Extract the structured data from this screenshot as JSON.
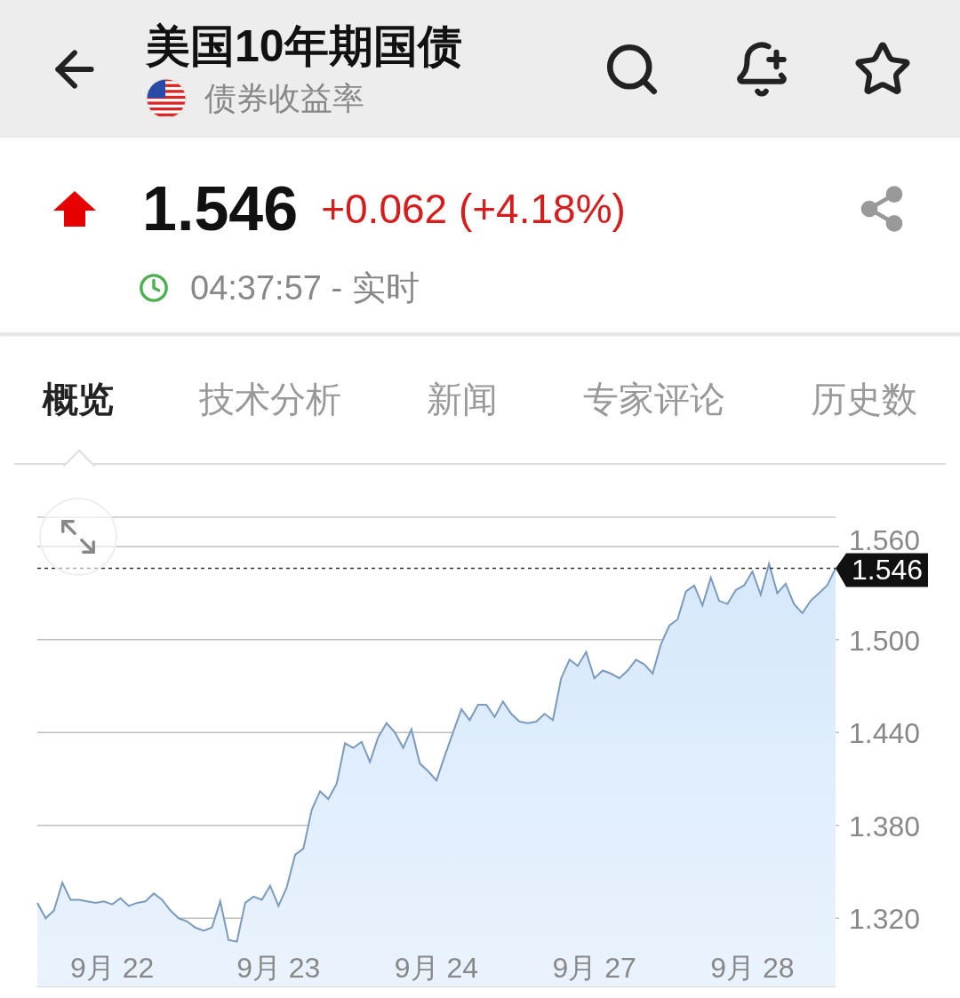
{
  "header": {
    "title": "美国10年期国债",
    "subtitle": "债券收益率"
  },
  "quote": {
    "price": "1.546",
    "change": "+0.062 (+4.18%)",
    "rising": true,
    "time": "04:37:57 - 实时"
  },
  "tabs": [
    {
      "label": "概览",
      "selected": true
    },
    {
      "label": "技术分析",
      "selected": false
    },
    {
      "label": "新闻",
      "selected": false
    },
    {
      "label": "专家评论",
      "selected": false
    },
    {
      "label": "历史数",
      "selected": false
    }
  ],
  "chart": {
    "chart_data": {
      "type": "area",
      "ylim": [
        1.276,
        1.579
      ],
      "categories": [
        null,
        null,
        null,
        null,
        null,
        null,
        null,
        null,
        null,
        "9月 22",
        null,
        null,
        null,
        null,
        null,
        null,
        null,
        null,
        null,
        null,
        null,
        null,
        null,
        null,
        null,
        null,
        null,
        null,
        null,
        "9月 23",
        null,
        null,
        null,
        null,
        null,
        null,
        null,
        null,
        null,
        null,
        null,
        null,
        null,
        null,
        null,
        null,
        null,
        null,
        "9月 24",
        null,
        null,
        null,
        null,
        null,
        null,
        null,
        null,
        null,
        null,
        null,
        null,
        null,
        null,
        null,
        null,
        null,
        null,
        "9月 27",
        null,
        null,
        null,
        null,
        null,
        null,
        null,
        null,
        null,
        null,
        null,
        null,
        null,
        null,
        null,
        null,
        null,
        null,
        "9月 28",
        null,
        null,
        null,
        null,
        null,
        null,
        null,
        null,
        null,
        null
      ],
      "grid": true,
      "ref_lines": [
        {
          "axis": "y",
          "value": 1.546,
          "label": "1.546"
        }
      ],
      "yticks": [
        {
          "value": 1.32,
          "label": "1.320"
        },
        {
          "value": 1.38,
          "label": "1.380"
        },
        {
          "value": 1.44,
          "label": "1.440"
        },
        {
          "value": 1.5,
          "label": "1.500"
        },
        {
          "value": 1.56,
          "label": "1.560"
        }
      ],
      "series": [
        {
          "color": "#7a9bbd",
          "values": [
            1.33,
            1.32,
            1.325,
            1.343,
            1.332,
            1.332,
            1.331,
            1.33,
            1.331,
            1.329,
            1.333,
            1.328,
            1.33,
            1.331,
            1.336,
            1.332,
            1.325,
            1.32,
            1.318,
            1.314,
            1.312,
            1.314,
            1.331,
            1.306,
            1.305,
            1.33,
            1.334,
            1.332,
            1.341,
            1.328,
            1.34,
            1.361,
            1.365,
            1.39,
            1.402,
            1.397,
            1.407,
            1.433,
            1.43,
            1.434,
            1.421,
            1.437,
            1.446,
            1.44,
            1.43,
            1.442,
            1.42,
            1.415,
            1.409,
            1.425,
            1.44,
            1.455,
            1.448,
            1.458,
            1.458,
            1.45,
            1.46,
            1.452,
            1.447,
            1.446,
            1.447,
            1.452,
            1.448,
            1.475,
            1.487,
            1.483,
            1.492,
            1.475,
            1.48,
            1.478,
            1.475,
            1.48,
            1.487,
            1.484,
            1.478,
            1.497,
            1.509,
            1.513,
            1.531,
            1.535,
            1.522,
            1.54,
            1.525,
            1.523,
            1.532,
            1.535,
            1.544,
            1.529,
            1.549,
            1.53,
            1.536,
            1.523,
            1.517,
            1.525,
            1.53,
            1.535,
            1.546
          ]
        }
      ]
    }
  }
}
